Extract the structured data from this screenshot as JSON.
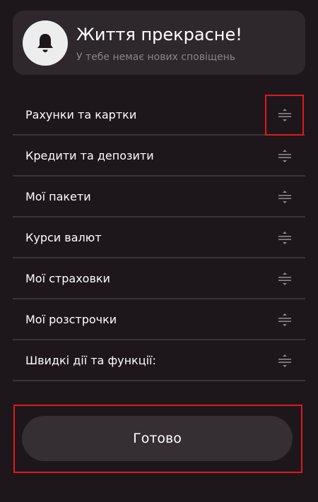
{
  "notification": {
    "title": "Життя прекрасне!",
    "subtitle": "У тебе немає нових сповіщень",
    "icon": "bell-icon"
  },
  "list": {
    "items": [
      {
        "label": "Рахунки та картки",
        "icon": "drag-handle-icon"
      },
      {
        "label": "Кредити та депозити",
        "icon": "drag-handle-icon"
      },
      {
        "label": "Мої пакети",
        "icon": "drag-handle-icon"
      },
      {
        "label": "Курси валют",
        "icon": "drag-handle-icon"
      },
      {
        "label": "Мої страховки",
        "icon": "drag-handle-icon"
      },
      {
        "label": "Мої розстрочки",
        "icon": "drag-handle-icon"
      },
      {
        "label": "Швидкі дії та функції:",
        "icon": "drag-handle-icon"
      }
    ]
  },
  "footer": {
    "done_label": "Готово"
  },
  "colors": {
    "background": "#1d171c",
    "card": "#2e282c",
    "button": "#352f33",
    "divider": "#3a3438",
    "highlight": "#e01818"
  }
}
